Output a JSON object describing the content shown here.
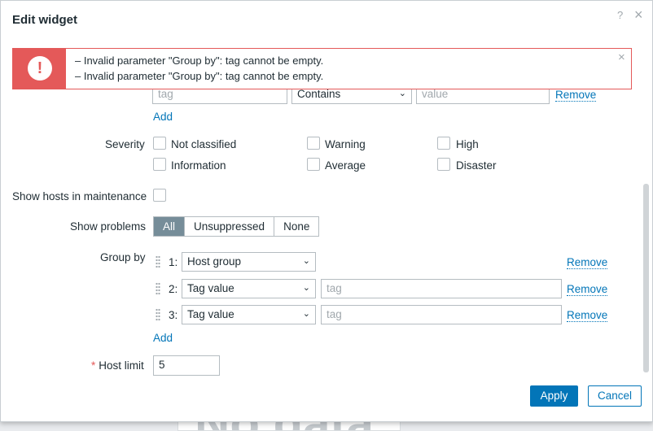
{
  "background": {
    "text": "No data"
  },
  "dialog": {
    "title": "Edit widget",
    "help_icon": "?",
    "close_icon": "×"
  },
  "alert": {
    "icon": "!",
    "messages": [
      "–  Invalid parameter \"Group by\": tag cannot be empty.",
      "–  Invalid parameter \"Group by\": tag cannot be empty."
    ],
    "close_icon": "×"
  },
  "tags_row": {
    "tag_placeholder": "tag",
    "operator": "Contains",
    "value_placeholder": "value",
    "remove_label": "Remove",
    "add_label": "Add"
  },
  "severity": {
    "label": "Severity",
    "options": [
      "Not classified",
      "Warning",
      "High",
      "Information",
      "Average",
      "Disaster"
    ]
  },
  "maintenance": {
    "label": "Show hosts in maintenance"
  },
  "show_problems": {
    "label": "Show problems",
    "options": [
      "All",
      "Unsuppressed",
      "None"
    ],
    "selected": "All"
  },
  "group_by": {
    "label": "Group by",
    "rows": [
      {
        "num": "1:",
        "select": "Host group",
        "tag_placeholder": "",
        "remove": "Remove"
      },
      {
        "num": "2:",
        "select": "Tag value",
        "tag_placeholder": "tag",
        "remove": "Remove"
      },
      {
        "num": "3:",
        "select": "Tag value",
        "tag_placeholder": "tag",
        "remove": "Remove"
      }
    ],
    "add_label": "Add"
  },
  "host_limit": {
    "label": "Host limit",
    "required_mark": "*",
    "value": "5"
  },
  "footer": {
    "apply_label": "Apply",
    "cancel_label": "Cancel"
  },
  "colors": {
    "accent": "#0275b8",
    "error": "#e45959",
    "segment_active": "#768d99"
  }
}
